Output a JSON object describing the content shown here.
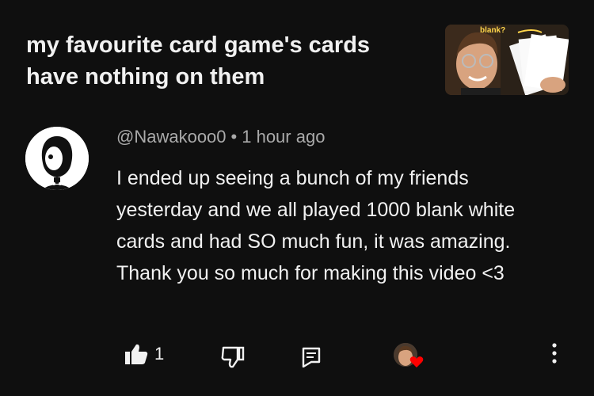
{
  "video": {
    "title": "my favourite card game's cards have nothing on them",
    "thumbnail_text": "blank?"
  },
  "comment": {
    "author": "@Nawakooo0",
    "separator": "•",
    "time": "1 hour ago",
    "text": "I ended up seeing a bunch of my friends yesterday and we all played 1000 blank white cards and had SO much fun, it was amazing. Thank you so much for making this video <3"
  },
  "actions": {
    "like_count": "1",
    "icons": [
      "thumbs-up-icon",
      "thumbs-down-icon",
      "reply-icon",
      "creator-heart-icon",
      "more-options-icon"
    ],
    "heart_color": "#ff0000"
  },
  "colors": {
    "background": "#0f0f0f",
    "text": "#f1f1f1",
    "secondary_text": "#aaaaaa"
  }
}
